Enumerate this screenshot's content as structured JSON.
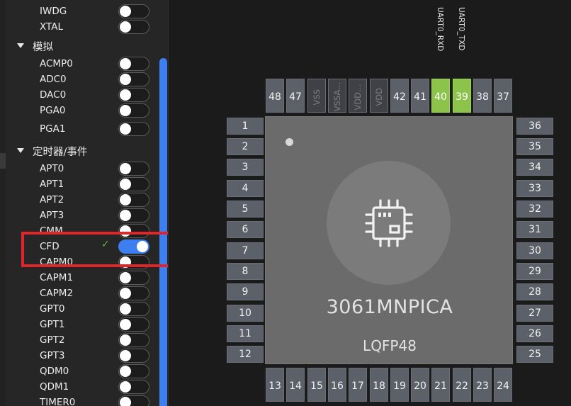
{
  "sidebar": {
    "items": [
      {
        "type": "item",
        "label": "IWDG",
        "enabled": false
      },
      {
        "type": "item",
        "label": "XTAL",
        "enabled": false
      },
      {
        "type": "group",
        "label": "模拟"
      },
      {
        "type": "item",
        "label": "ACMP0",
        "enabled": false
      },
      {
        "type": "item",
        "label": "ADC0",
        "enabled": false
      },
      {
        "type": "item",
        "label": "DAC0",
        "enabled": false
      },
      {
        "type": "item",
        "label": "PGA0",
        "enabled": false
      },
      {
        "type": "item",
        "label": "PGA1",
        "enabled": false
      },
      {
        "type": "group",
        "label": "定时器/事件"
      },
      {
        "type": "item",
        "label": "APT0",
        "enabled": false
      },
      {
        "type": "item",
        "label": "APT1",
        "enabled": false
      },
      {
        "type": "item",
        "label": "APT2",
        "enabled": false
      },
      {
        "type": "item",
        "label": "APT3",
        "enabled": false
      },
      {
        "type": "item",
        "label": "CMM",
        "enabled": false
      },
      {
        "type": "item",
        "label": "CFD",
        "enabled": true,
        "check": "✓"
      },
      {
        "type": "item",
        "label": "CAPM0",
        "enabled": false
      },
      {
        "type": "item",
        "label": "CAPM1",
        "enabled": false
      },
      {
        "type": "item",
        "label": "CAPM2",
        "enabled": false
      },
      {
        "type": "item",
        "label": "GPT0",
        "enabled": false
      },
      {
        "type": "item",
        "label": "GPT1",
        "enabled": false
      },
      {
        "type": "item",
        "label": "GPT2",
        "enabled": false
      },
      {
        "type": "item",
        "label": "GPT3",
        "enabled": false
      },
      {
        "type": "item",
        "label": "QDM0",
        "enabled": false
      },
      {
        "type": "item",
        "label": "QDM1",
        "enabled": false
      },
      {
        "type": "item",
        "label": "TIMER0",
        "enabled": false
      }
    ]
  },
  "chip": {
    "name": "3061MNPICA",
    "package": "LQFP48",
    "icon": "chip-icon",
    "top_pins": [
      {
        "label": "48",
        "state": "normal"
      },
      {
        "label": "47",
        "state": "normal"
      },
      {
        "label": "VSS",
        "state": "dim"
      },
      {
        "label": "VSSA...",
        "state": "dim"
      },
      {
        "label": "VDD...",
        "state": "dim"
      },
      {
        "label": "VDD",
        "state": "dim"
      },
      {
        "label": "42",
        "state": "normal"
      },
      {
        "label": "41",
        "state": "normal"
      },
      {
        "label": "40",
        "state": "active",
        "signal": "UART0_RXD"
      },
      {
        "label": "39",
        "state": "active",
        "signal": "UART0_TXD"
      },
      {
        "label": "38",
        "state": "normal"
      },
      {
        "label": "37",
        "state": "normal"
      }
    ],
    "bottom_pins": [
      "13",
      "14",
      "15",
      "16",
      "17",
      "18",
      "19",
      "20",
      "21",
      "22",
      "23",
      "24"
    ],
    "left_pins": [
      "1",
      "2",
      "3",
      "4",
      "5",
      "6",
      "7",
      "8",
      "9",
      "10",
      "11",
      "12"
    ],
    "right_pins": [
      "36",
      "35",
      "34",
      "33",
      "32",
      "31",
      "30",
      "29",
      "28",
      "27",
      "26",
      "25"
    ],
    "colors": {
      "active": "#8cc34a",
      "toggle_on": "#3d7ef0",
      "highlight": "#e0262b"
    }
  }
}
